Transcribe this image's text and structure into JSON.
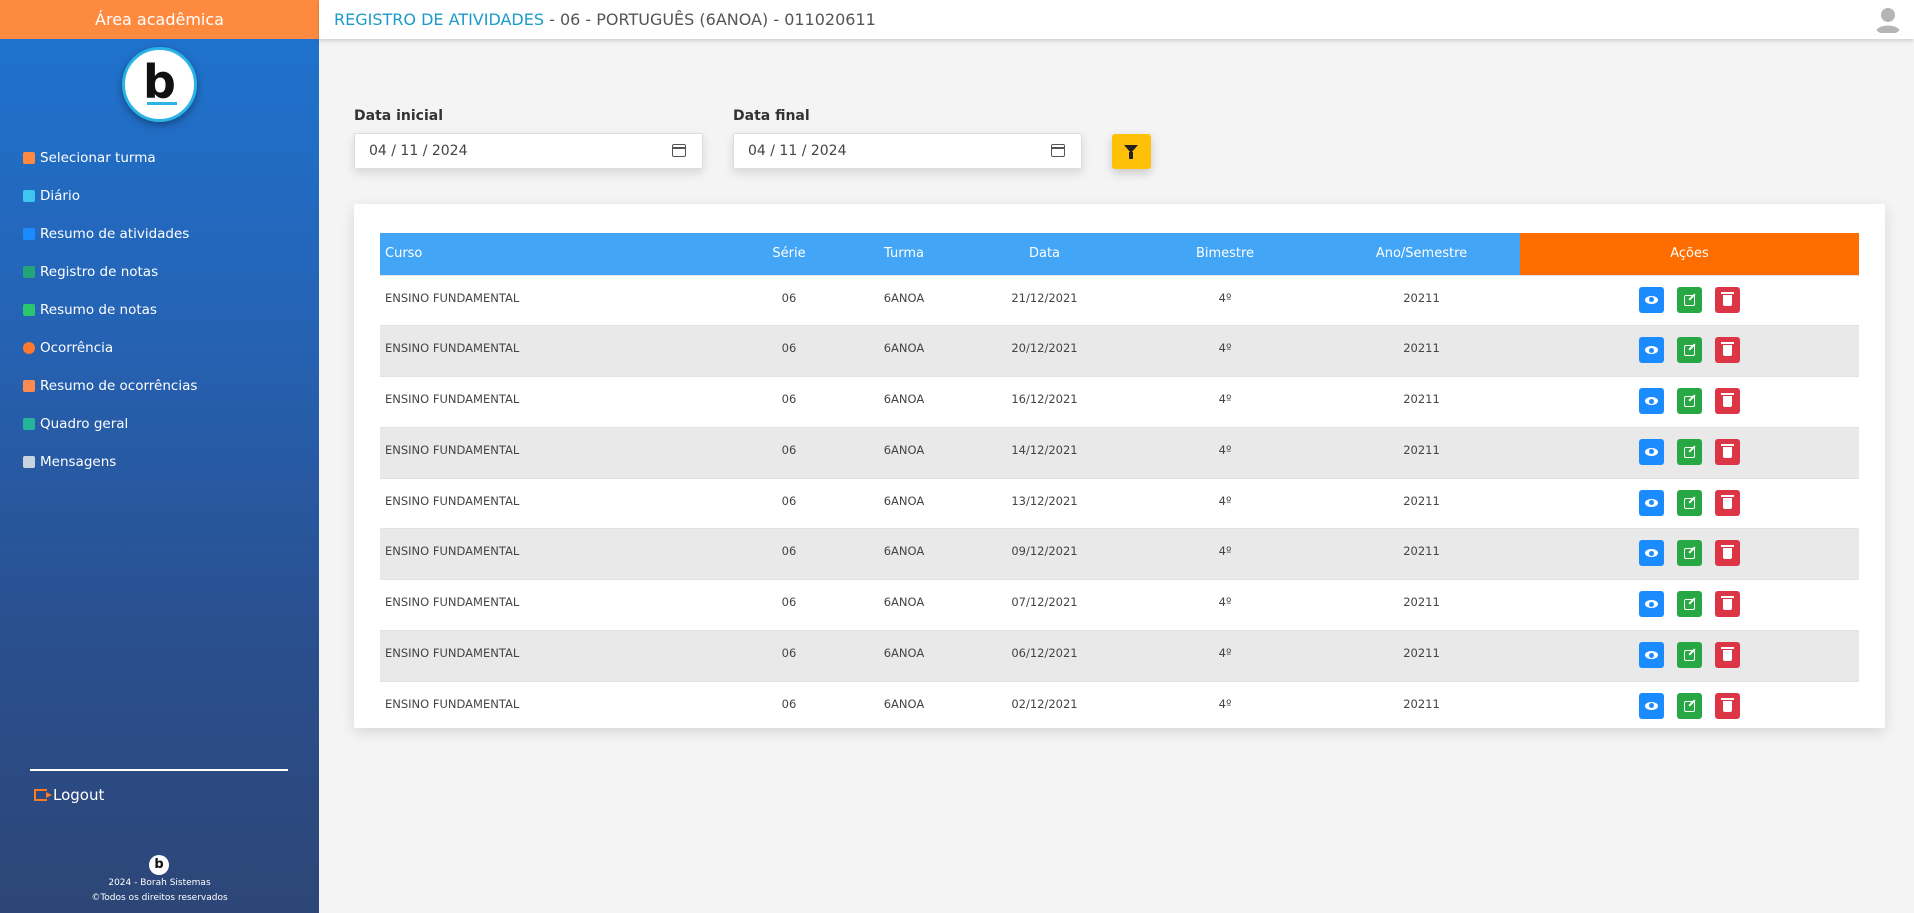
{
  "sidebar": {
    "header": "Área acadêmica",
    "logo_letter": "b",
    "items": [
      {
        "label": "Selecionar turma",
        "icon": "users-icon",
        "color": "#fd8a3e"
      },
      {
        "label": "Diário",
        "icon": "calendar-check-icon",
        "color": "#3ec6f0"
      },
      {
        "label": "Resumo de atividades",
        "icon": "file-icon",
        "color": "#1a8cff"
      },
      {
        "label": "Registro de notas",
        "icon": "file-lines-icon",
        "color": "#21a67a"
      },
      {
        "label": "Resumo de notas",
        "icon": "clipboard-icon",
        "color": "#28c76f"
      },
      {
        "label": "Ocorrência",
        "icon": "exclamation-circle-icon",
        "color": "#ff7a2f"
      },
      {
        "label": "Resumo de ocorrências",
        "icon": "file-alt-icon",
        "color": "#ff8a50"
      },
      {
        "label": "Quadro geral",
        "icon": "book-icon",
        "color": "#26b59a"
      },
      {
        "label": "Mensagens",
        "icon": "envelope-icon",
        "color": "#c9d3e0"
      }
    ],
    "logout": "Logout",
    "footer_line1": "2024 - Borah Sistemas",
    "footer_line2": "©Todos os direitos reservados"
  },
  "header": {
    "title_accent": "REGISTRO DE ATIVIDADES",
    "title_rest": " - 06 - PORTUGUÊS (6ANOA) - 011020611"
  },
  "filters": {
    "start_label": "Data inicial",
    "start_value": "04 / 11 / 2024",
    "end_label": "Data final",
    "end_value": "04 / 11 / 2024"
  },
  "table": {
    "columns": [
      "Curso",
      "Série",
      "Turma",
      "Data",
      "Bimestre",
      "Ano/Semestre",
      "Ações"
    ],
    "rows": [
      [
        "ENSINO FUNDAMENTAL",
        "06",
        "6ANOA",
        "21/12/2021",
        "4º",
        "20211"
      ],
      [
        "ENSINO FUNDAMENTAL",
        "06",
        "6ANOA",
        "20/12/2021",
        "4º",
        "20211"
      ],
      [
        "ENSINO FUNDAMENTAL",
        "06",
        "6ANOA",
        "16/12/2021",
        "4º",
        "20211"
      ],
      [
        "ENSINO FUNDAMENTAL",
        "06",
        "6ANOA",
        "14/12/2021",
        "4º",
        "20211"
      ],
      [
        "ENSINO FUNDAMENTAL",
        "06",
        "6ANOA",
        "13/12/2021",
        "4º",
        "20211"
      ],
      [
        "ENSINO FUNDAMENTAL",
        "06",
        "6ANOA",
        "09/12/2021",
        "4º",
        "20211"
      ],
      [
        "ENSINO FUNDAMENTAL",
        "06",
        "6ANOA",
        "07/12/2021",
        "4º",
        "20211"
      ],
      [
        "ENSINO FUNDAMENTAL",
        "06",
        "6ANOA",
        "06/12/2021",
        "4º",
        "20211"
      ],
      [
        "ENSINO FUNDAMENTAL",
        "06",
        "6ANOA",
        "02/12/2021",
        "4º",
        "20211"
      ]
    ]
  }
}
